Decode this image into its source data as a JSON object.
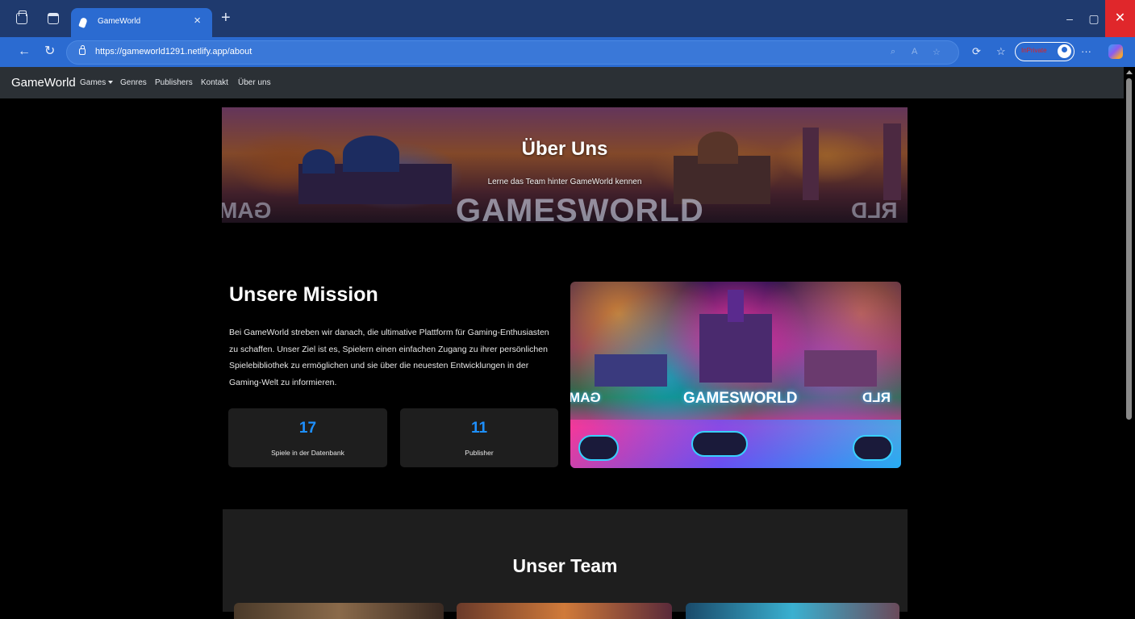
{
  "browser": {
    "tab_title": "GameWorld",
    "tab_close": "×",
    "new_tab": "+",
    "url": "https://gameworld1291.netlify.app/about",
    "profile_label": "InPrivate",
    "window_controls": {
      "minimize": "–",
      "maximize": "▢",
      "close": "✕"
    },
    "nav_glyphs": {
      "back": "←",
      "reload": "↻",
      "more": "···"
    },
    "icons": [
      "tab-actions-icon",
      "workspaces-icon",
      "lock-icon",
      "zoom-icon",
      "read-aloud-icon",
      "favorite-star-icon",
      "extensions-icon",
      "favorites-icon",
      "profile-icon",
      "more-icon",
      "copilot-icon"
    ],
    "accent_color": "#2b6bd1",
    "frame_color": "#1f3a6e"
  },
  "site": {
    "brand": "GameWorld",
    "nav": {
      "games": "Games",
      "genres": "Genres",
      "publishers": "Publishers",
      "contact": "Kontakt",
      "about": "Über uns"
    },
    "hero": {
      "title": "Über Uns",
      "subtitle": "Lerne das Team hinter GameWorld kennen",
      "image_logo_text": "GAMESWORLD"
    },
    "mission": {
      "heading": "Unsere Mission",
      "text": "Bei GameWorld streben wir danach, die ultimative Plattform für Gaming-Enthusiasten zu schaffen. Unser Ziel ist es, Spielern einen einfachen Zugang zu ihrer persönlichen Spielebibliothek zu ermöglichen und sie über die neuesten Entwicklungen in der Gaming-Welt zu informieren.",
      "stats": [
        {
          "value": "17",
          "label": "Spiele in der Datenbank"
        },
        {
          "value": "11",
          "label": "Publisher"
        }
      ],
      "stat_color": "#1e90ff",
      "image_logo_text": "GAMESWORLD"
    },
    "team": {
      "heading": "Unser Team"
    }
  }
}
